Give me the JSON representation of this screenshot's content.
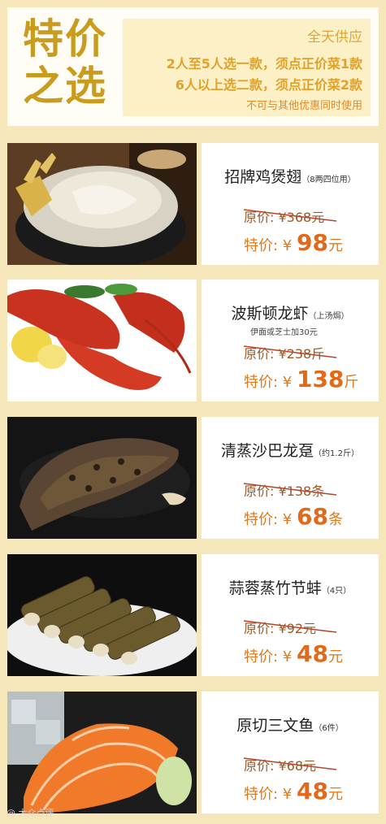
{
  "header": {
    "title_line1": "特价",
    "title_line2": "之选",
    "availability": "全天供应",
    "rule1": "2人至5人选一款，须点正价菜1款",
    "rule2": "6人以上选二款，须点正价菜2款",
    "note": "不可与其他优惠同时使用"
  },
  "items": [
    {
      "name": "招牌鸡煲翅",
      "note": "（8两四位用）",
      "subnote": "",
      "orig_label": "原价: ¥",
      "orig_price": "368",
      "orig_unit": "元",
      "sale_label": "特价: ¥ ",
      "sale_price": "98",
      "sale_unit": "元"
    },
    {
      "name": "波斯顿龙虾",
      "note": "（上汤焗）",
      "subnote": "伊面或芝士加30元",
      "orig_label": "原价: ¥",
      "orig_price": "238",
      "orig_unit": "斤",
      "sale_label": "特价: ¥ ",
      "sale_price": "138",
      "sale_unit": "斤"
    },
    {
      "name": "清蒸沙巴龙趸",
      "note": "（约1.2斤）",
      "subnote": "",
      "orig_label": "原价: ¥",
      "orig_price": "138",
      "orig_unit": "条",
      "sale_label": "特价: ¥ ",
      "sale_price": "68",
      "sale_unit": "条"
    },
    {
      "name": "蒜蓉蒸竹节蚌",
      "note": "（4只）",
      "subnote": "",
      "orig_label": "原价: ¥",
      "orig_price": "92",
      "orig_unit": "元",
      "sale_label": "特价: ¥ ",
      "sale_price": "48",
      "sale_unit": "元"
    },
    {
      "name": "原切三文鱼",
      "note": "（6件）",
      "subnote": "",
      "orig_label": "原价: ¥",
      "orig_price": "68",
      "orig_unit": "元",
      "sale_label": "特价: ¥ ",
      "sale_price": "48",
      "sale_unit": "元"
    }
  ],
  "watermark": "@ 大众点评",
  "colors": {
    "background": "#f6e7bb",
    "title": "#c99c1e",
    "info_box": "#fbf0c6",
    "sale": "#e2691a",
    "strike": "#b4452a"
  }
}
